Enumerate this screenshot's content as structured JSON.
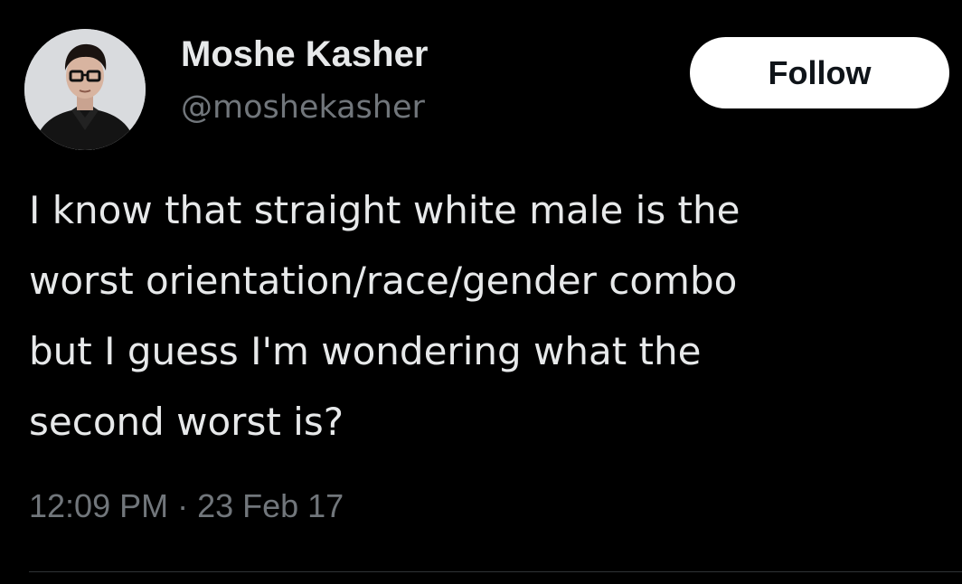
{
  "author": {
    "display_name": "Moshe Kasher",
    "handle": "@moshekasher"
  },
  "follow_button": {
    "label": "Follow"
  },
  "tweet": {
    "lines": [
      "I know that straight white male is the",
      "worst orientation/race/gender combo",
      "but I guess I'm wondering what the",
      "second worst is?"
    ],
    "timestamp": "12:09 PM · 23 Feb 17"
  },
  "colors": {
    "background": "#000000",
    "primary_text": "#e7e9ea",
    "secondary_text": "#71767b",
    "follow_button_bg": "#ffffff",
    "follow_button_text": "#0f1419",
    "divider": "#2f3336"
  },
  "icons": {
    "avatar": "profile-photo"
  }
}
